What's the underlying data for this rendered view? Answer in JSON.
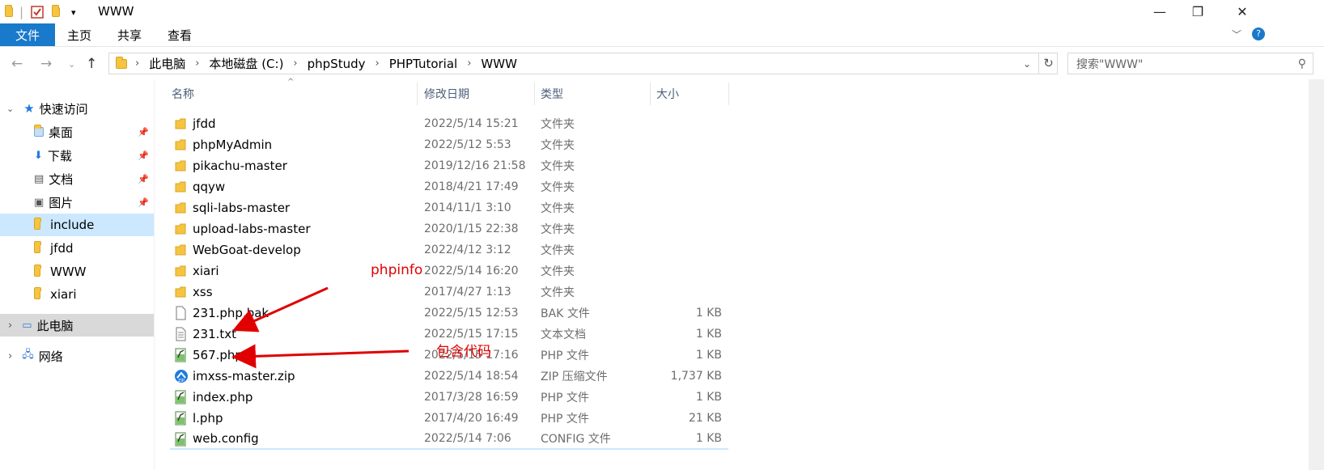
{
  "window": {
    "title": "WWW",
    "minimize": "—",
    "maximize": "❐",
    "close": "✕"
  },
  "ribbon": {
    "tabs": [
      "文件",
      "主页",
      "共享",
      "查看"
    ]
  },
  "address": {
    "crumbs": [
      "此电脑",
      "本地磁盘 (C:)",
      "phpStudy",
      "PHPTutorial",
      "WWW"
    ],
    "search_placeholder": "搜索\"WWW\""
  },
  "sidebar": {
    "quick_access": "快速访问",
    "items": [
      {
        "label": "桌面",
        "pinned": true
      },
      {
        "label": "下载",
        "pinned": true
      },
      {
        "label": "文档",
        "pinned": true
      },
      {
        "label": "图片",
        "pinned": true
      },
      {
        "label": "include",
        "pinned": false
      },
      {
        "label": "jfdd",
        "pinned": false
      },
      {
        "label": "WWW",
        "pinned": false
      },
      {
        "label": "xiari",
        "pinned": false
      }
    ],
    "this_pc": "此电脑",
    "network": "网络"
  },
  "columns": {
    "name": "名称",
    "date": "修改日期",
    "type": "类型",
    "size": "大小"
  },
  "files": [
    {
      "name": "jfdd",
      "date": "2022/5/14 15:21",
      "type": "文件夹",
      "size": "",
      "icon": "folder-icon"
    },
    {
      "name": "phpMyAdmin",
      "date": "2022/5/12 5:53",
      "type": "文件夹",
      "size": "",
      "icon": "folder-icon"
    },
    {
      "name": "pikachu-master",
      "date": "2019/12/16 21:58",
      "type": "文件夹",
      "size": "",
      "icon": "folder-icon"
    },
    {
      "name": "qqyw",
      "date": "2018/4/21 17:49",
      "type": "文件夹",
      "size": "",
      "icon": "folder-icon"
    },
    {
      "name": "sqli-labs-master",
      "date": "2014/11/1 3:10",
      "type": "文件夹",
      "size": "",
      "icon": "folder-icon"
    },
    {
      "name": "upload-labs-master",
      "date": "2020/1/15 22:38",
      "type": "文件夹",
      "size": "",
      "icon": "folder-icon"
    },
    {
      "name": "WebGoat-develop",
      "date": "2022/4/12 3:12",
      "type": "文件夹",
      "size": "",
      "icon": "folder-icon"
    },
    {
      "name": "xiari",
      "date": "2022/5/14 16:20",
      "type": "文件夹",
      "size": "",
      "icon": "folder-icon"
    },
    {
      "name": "xss",
      "date": "2017/4/27 1:13",
      "type": "文件夹",
      "size": "",
      "icon": "folder-icon"
    },
    {
      "name": "231.php.bak",
      "date": "2022/5/15 12:53",
      "type": "BAK 文件",
      "size": "1 KB",
      "icon": "blank-file-icon"
    },
    {
      "name": "231.txt",
      "date": "2022/5/15 17:15",
      "type": "文本文档",
      "size": "1 KB",
      "icon": "text-file-icon"
    },
    {
      "name": "567.php",
      "date": "2022/5/15 17:16",
      "type": "PHP 文件",
      "size": "1 KB",
      "icon": "php-file-icon"
    },
    {
      "name": "imxss-master.zip",
      "date": "2022/5/14 18:54",
      "type": "ZIP 压缩文件",
      "size": "1,737 KB",
      "icon": "zip-file-icon"
    },
    {
      "name": "index.php",
      "date": "2017/3/28 16:59",
      "type": "PHP 文件",
      "size": "1 KB",
      "icon": "php-file-icon"
    },
    {
      "name": "l.php",
      "date": "2017/4/20 16:49",
      "type": "PHP 文件",
      "size": "21 KB",
      "icon": "php-file-icon"
    },
    {
      "name": "web.config",
      "date": "2022/5/14 7:06",
      "type": "CONFIG 文件",
      "size": "1 KB",
      "icon": "php-file-icon"
    }
  ],
  "annotations": {
    "phpinfo": "phpinfo",
    "include_code": "包含代码",
    "color": "#e00000"
  }
}
